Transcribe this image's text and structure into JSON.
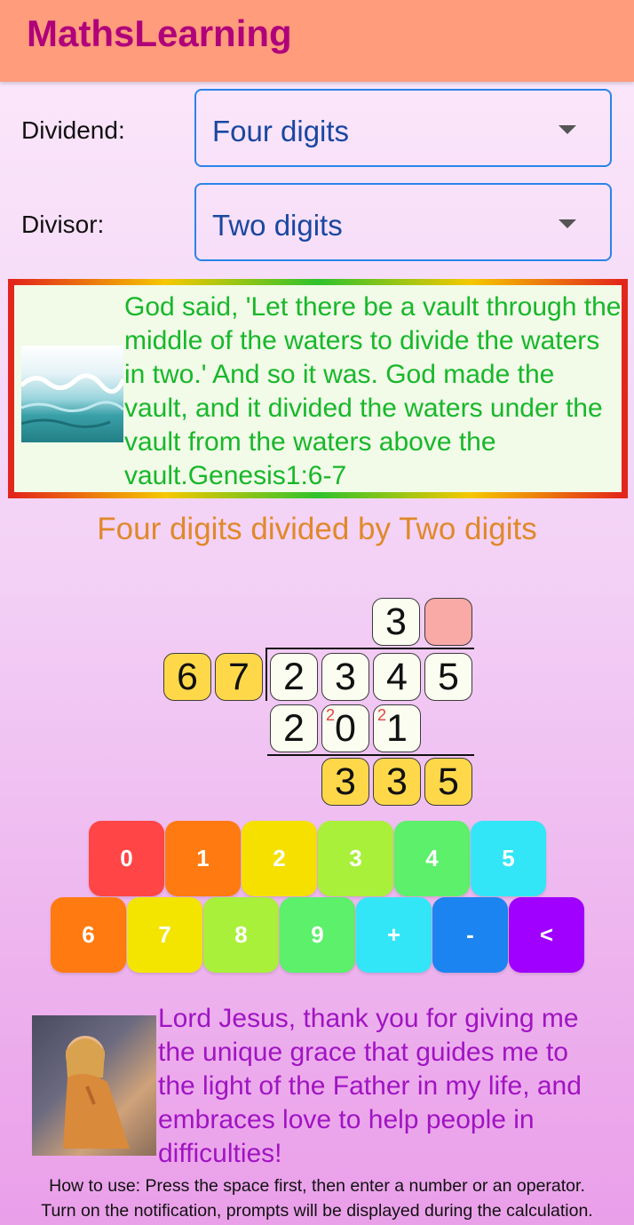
{
  "app": {
    "title": "MathsLearning"
  },
  "dividend": {
    "label": "Dividend:",
    "value": "Four digits"
  },
  "divisor": {
    "label": "Divisor:",
    "value": "Two digits"
  },
  "verse": {
    "image": "ocean-waves-image",
    "text": "God said, 'Let there be a vault through the middle of the waters to divide the waters in two.' And so it was. God made the vault, and it divided the waters under the vault from the waters above the vault.Genesis1:6-7"
  },
  "problem_title": "Four digits divided by Two digits",
  "division": {
    "quotient": [
      "3",
      ""
    ],
    "divisor": [
      "6",
      "7"
    ],
    "dividend": [
      "2",
      "3",
      "4",
      "5"
    ],
    "product": [
      "2",
      "0",
      "1"
    ],
    "carries": [
      "2",
      "2"
    ],
    "remainder": [
      "3",
      "3",
      "5"
    ]
  },
  "keypad": {
    "row1": [
      {
        "label": "0",
        "color": "#ff4545"
      },
      {
        "label": "1",
        "color": "#ff7b11"
      },
      {
        "label": "2",
        "color": "#f5e000"
      },
      {
        "label": "3",
        "color": "#a9f03a"
      },
      {
        "label": "4",
        "color": "#5cf06b"
      },
      {
        "label": "5",
        "color": "#33e6f7"
      }
    ],
    "row2": [
      {
        "label": "6",
        "color": "#ff7b11"
      },
      {
        "label": "7",
        "color": "#f3e500"
      },
      {
        "label": "8",
        "color": "#a9f03a"
      },
      {
        "label": "9",
        "color": "#5cf06b"
      },
      {
        "label": "+",
        "color": "#33e6f7"
      },
      {
        "label": "-",
        "color": "#1b84f0"
      },
      {
        "label": "<",
        "color": "#a000ff"
      }
    ]
  },
  "prayer": {
    "image": "praying-girl-image",
    "text": "Lord Jesus, thank you for giving me the unique grace that guides me to the light of the Father in my life, and embraces love to help people in difficulties!"
  },
  "howto": {
    "line1": "How to use: Press the space first, then enter a number or an operator.",
    "line2": "Turn on the notification, prompts will be displayed during the calculation."
  }
}
